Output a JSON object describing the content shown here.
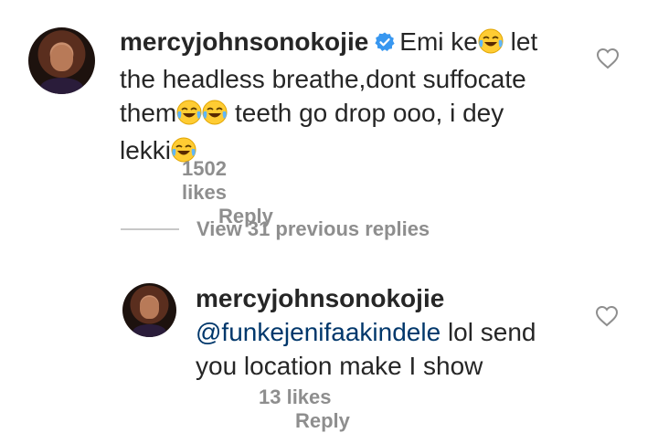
{
  "comment": {
    "username": "mercyjohnsonokojie",
    "verified_icon": "verified-badge-icon",
    "text_parts": [
      "Emi ke",
      "let the headless breathe,dont suffocate them",
      "teeth go drop ooo, i dey lekki"
    ],
    "line1_a": "Emi ke",
    "line1_b": "let",
    "line2": "the headless breathe,dont suffocate",
    "line3_a": "them",
    "line3_b": "teeth go drop ooo, i dey",
    "line4": "lekki",
    "likes": "1502 likes",
    "reply_label": "Reply",
    "emoji_icon": "face-with-tears-of-joy-emoji"
  },
  "thread": {
    "view_replies_label": "View 31 previous replies"
  },
  "reply": {
    "username": "mercyjohnsonokojie",
    "mention": "@funkejenifaakindele",
    "text_line1": " lol send",
    "text_line2": "you location make I show",
    "likes": "13 likes",
    "reply_label": "Reply"
  },
  "colors": {
    "text": "#262626",
    "secondary": "#8e8e8e",
    "mention": "#00376b",
    "verified": "#3897f0"
  }
}
